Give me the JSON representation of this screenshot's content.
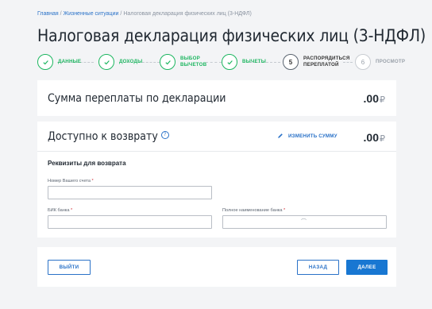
{
  "breadcrumb": {
    "home": "Главная",
    "section": "Жизненные ситуации",
    "current": "Налоговая декларация физических лиц (3-НДФЛ)"
  },
  "page_title": "Налоговая декларация физических лиц (3-НДФЛ)",
  "steps": [
    {
      "label": "Данные",
      "status": "done"
    },
    {
      "label": "Доходы",
      "status": "done"
    },
    {
      "label": "Выбор вычетов",
      "status": "done"
    },
    {
      "label": "Вычеты",
      "status": "done"
    },
    {
      "number": "5",
      "label": "Распорядиться переплатой",
      "status": "current"
    },
    {
      "number": "6",
      "label": "Просмотр",
      "status": "future"
    }
  ],
  "overpayment": {
    "title": "Сумма переплаты по декларации",
    "amount": ".00",
    "currency": "₽"
  },
  "refund": {
    "title": "Доступно к возврату",
    "help_icon": "?",
    "edit_label": "Изменить сумму",
    "amount": ".00",
    "currency": "₽",
    "details_title": "Реквизиты для возврата",
    "account_label": "Номер Вашего счета",
    "bik_label": "БИК банка",
    "bank_name_label": "Полное наименование банка",
    "required_mark": "*",
    "account_value": "",
    "bik_value": "",
    "bank_name_value": ""
  },
  "actions": {
    "exit": "Выйти",
    "back": "Назад",
    "next": "Далее"
  },
  "colors": {
    "accent_green": "#1db660",
    "accent_blue": "#1877d2",
    "link_blue": "#2a72c8",
    "background": "#f3f4f6"
  }
}
